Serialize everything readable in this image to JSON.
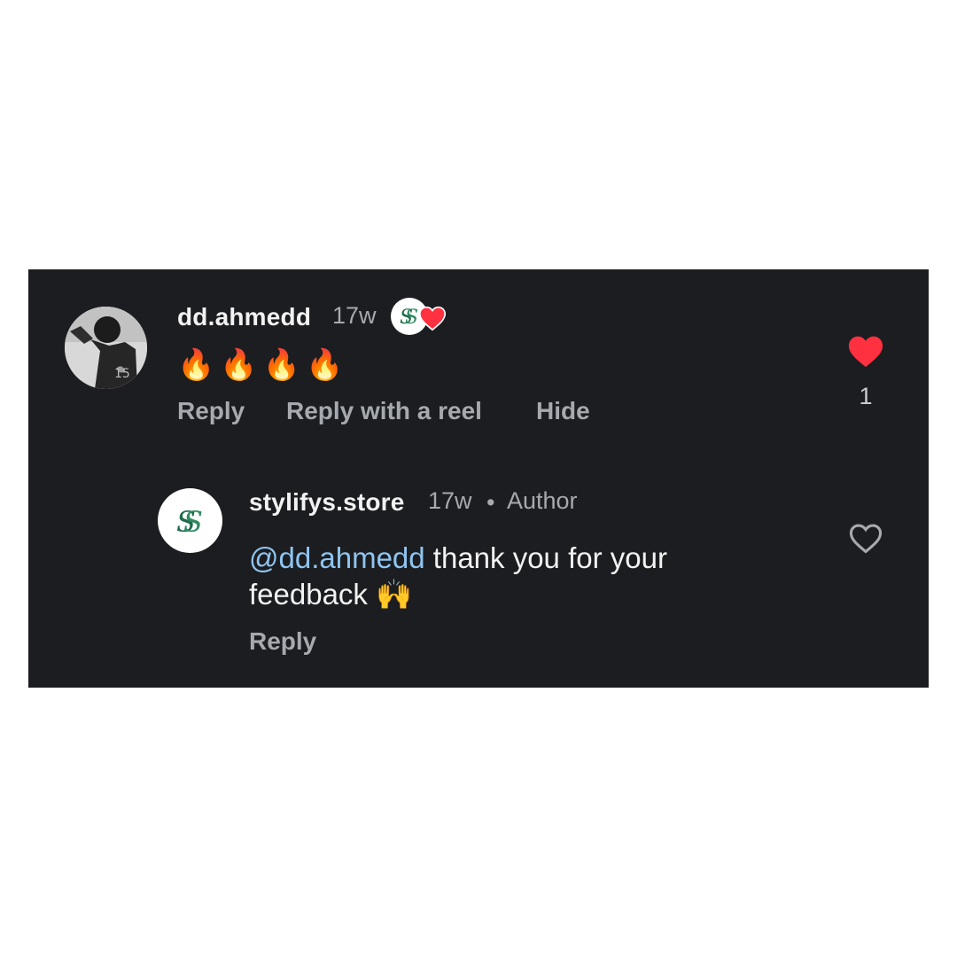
{
  "comment": {
    "username": "dd.ahmedd",
    "time": "17w",
    "text": "🔥🔥🔥🔥",
    "actions": {
      "reply": "Reply",
      "reply_reel": "Reply with a reel",
      "hide": "Hide"
    },
    "like_count": "1",
    "liked": true,
    "creator_liked": true
  },
  "reply": {
    "username": "stylifys.store",
    "time": "17w",
    "separator": "•",
    "badge": "Author",
    "mention": "@dd.ahmedd",
    "text_line1": " thank you for your",
    "text_line2": "feedback 🙌",
    "actions": {
      "reply": "Reply"
    },
    "liked": false
  },
  "icons": {
    "like_filled": "heart-filled-icon",
    "like_outline": "heart-outline-icon",
    "logo": "S-monogram"
  },
  "colors": {
    "background": "#1b1d20",
    "like_red": "#ff3040",
    "mention_blue": "#8fc4f0",
    "logo_green": "#1f6b4a"
  }
}
